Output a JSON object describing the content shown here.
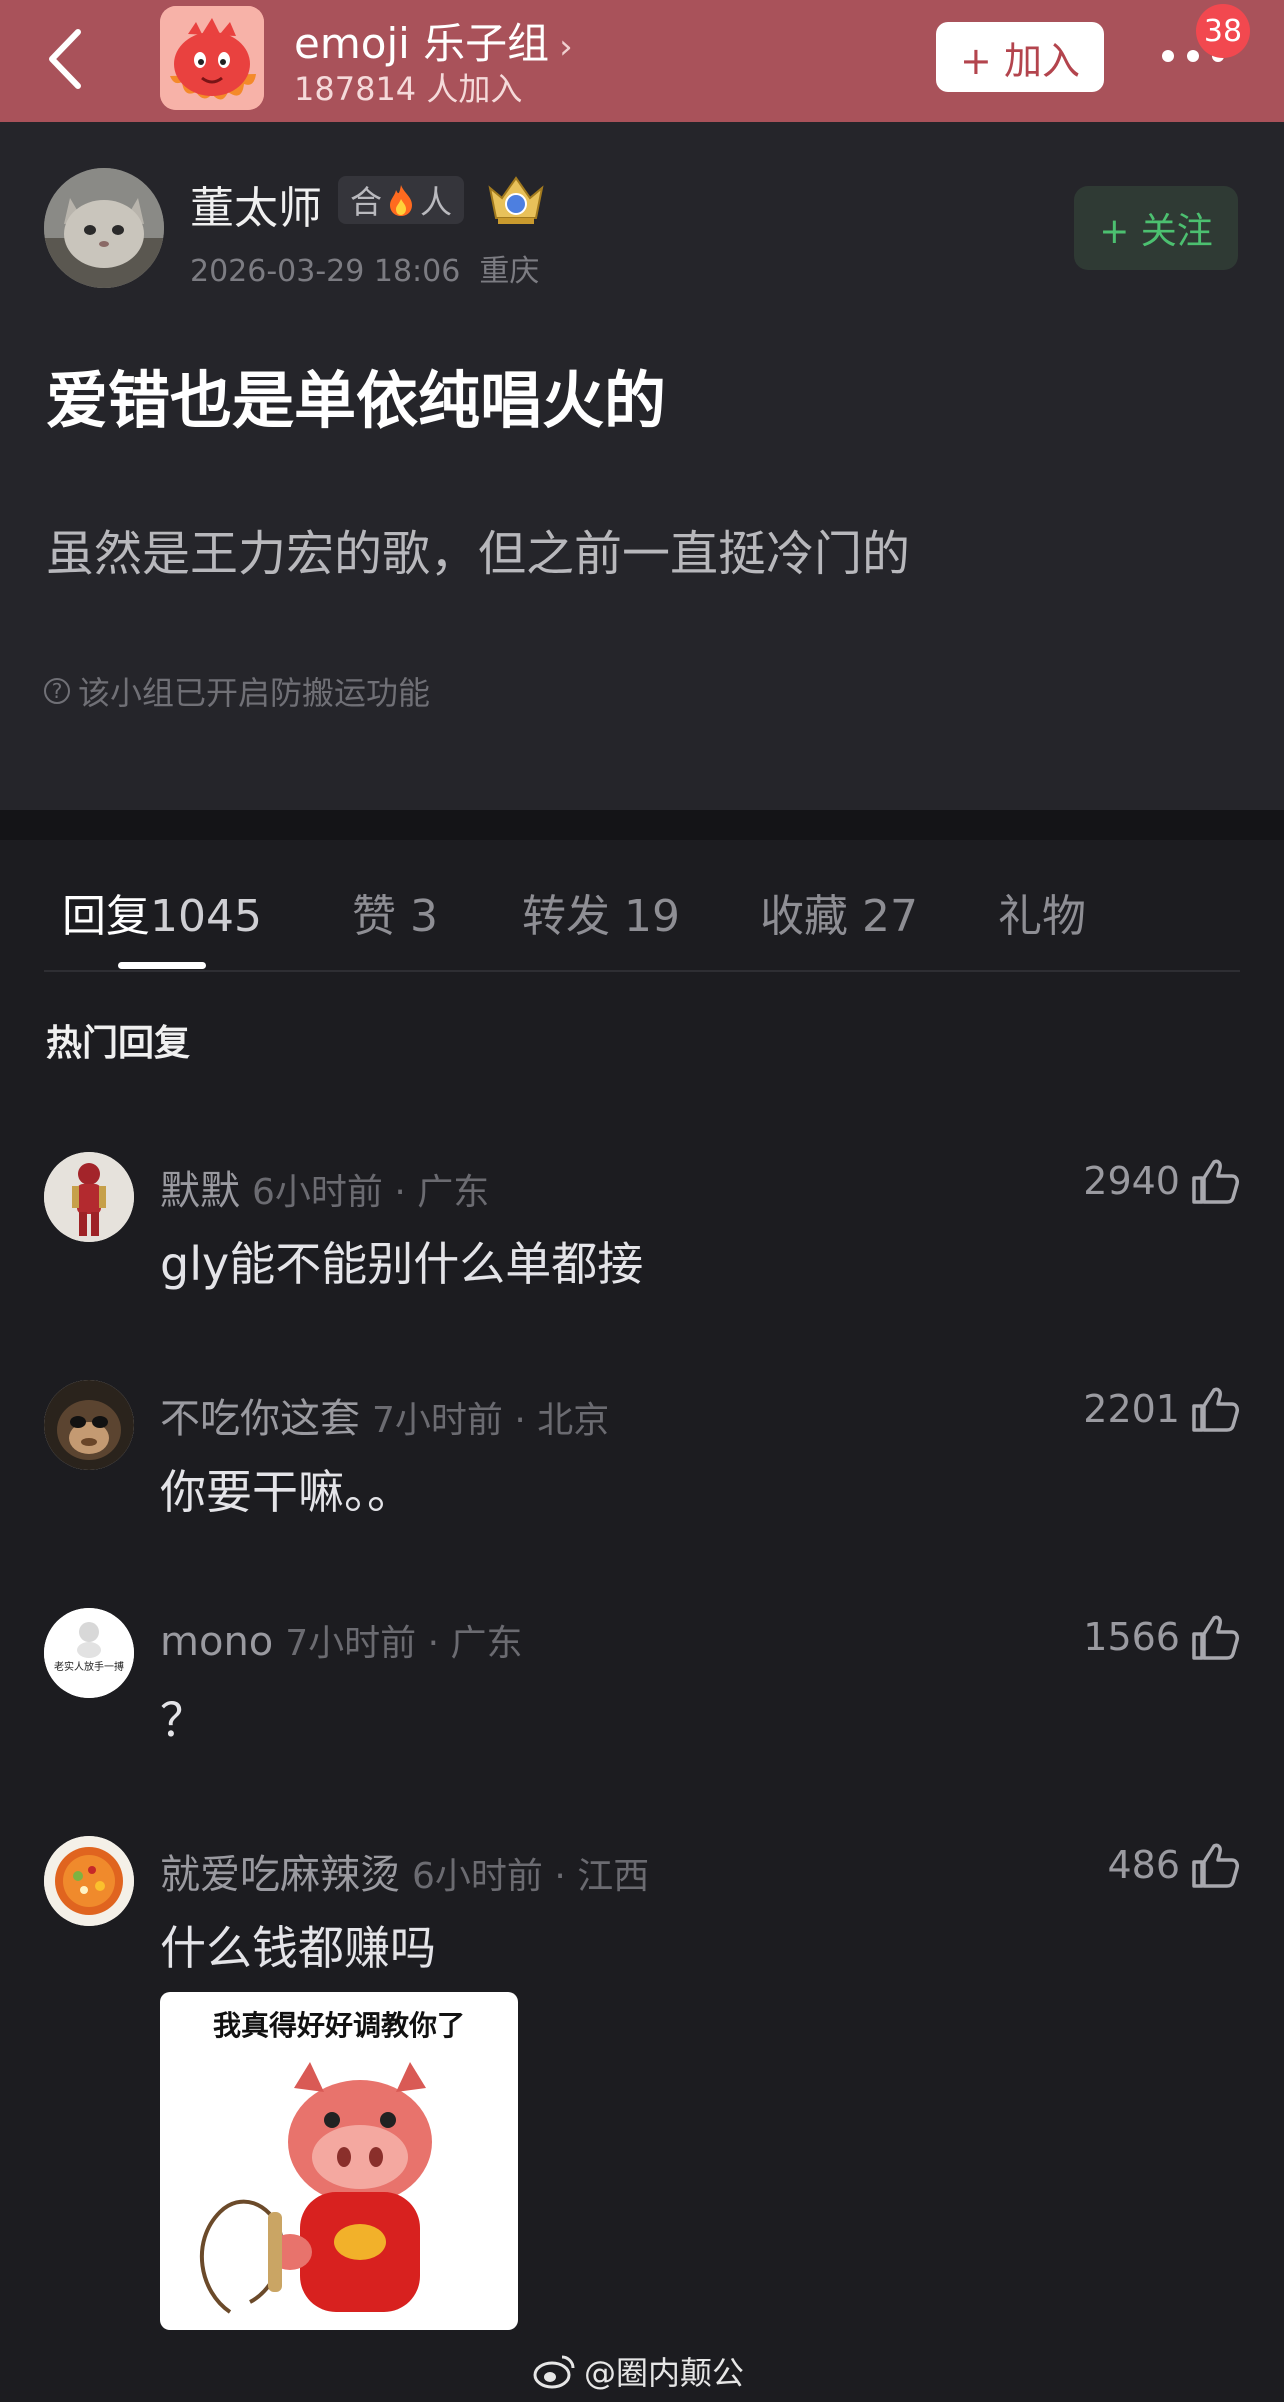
{
  "header": {
    "group_name": "emoji 乐子组",
    "member_count": "187814 人加入",
    "join_label": "+ 加入",
    "notification_count": "38",
    "bar_color": "#a9525a"
  },
  "post": {
    "author_name": "董太师",
    "tag_left": "合",
    "tag_right": "人",
    "timestamp": "2026-03-29 18:06",
    "location": "重庆",
    "follow_label": "+ 关注",
    "title": "爱错也是单依纯唱火的",
    "body": "虽然是王力宏的歌，但之前一直挺冷门的",
    "notice": "该小组已开启防搬运功能"
  },
  "tabs": [
    {
      "label": "回复",
      "count": "1045"
    },
    {
      "label": "赞",
      "count": "3"
    },
    {
      "label": "转发",
      "count": "19"
    },
    {
      "label": "收藏",
      "count": "27"
    },
    {
      "label": "礼物",
      "count": ""
    }
  ],
  "hot_replies_title": "热门回复",
  "comments": [
    {
      "user": "默默",
      "meta": "6小时前 · 广东",
      "text": "gly能不能别什么单都接",
      "likes": "2940"
    },
    {
      "user": "不吃你这套",
      "meta": "7小时前 · 北京",
      "text": "你要干嘛。。",
      "likes": "2201"
    },
    {
      "user": "mono",
      "meta": "7小时前 · 广东",
      "text": "？",
      "likes": "1566",
      "avatar_text": "老实人放手一搏"
    },
    {
      "user": "就爱吃麻辣烫",
      "meta": "6小时前 · 江西",
      "text": "什么钱都赚吗",
      "likes": "486"
    }
  ],
  "sticker_caption": "我真得好好调教你了",
  "watermark": "@圈内颠公",
  "colors": {
    "accent_green": "#4cc070",
    "badge_red": "#f2484f"
  }
}
